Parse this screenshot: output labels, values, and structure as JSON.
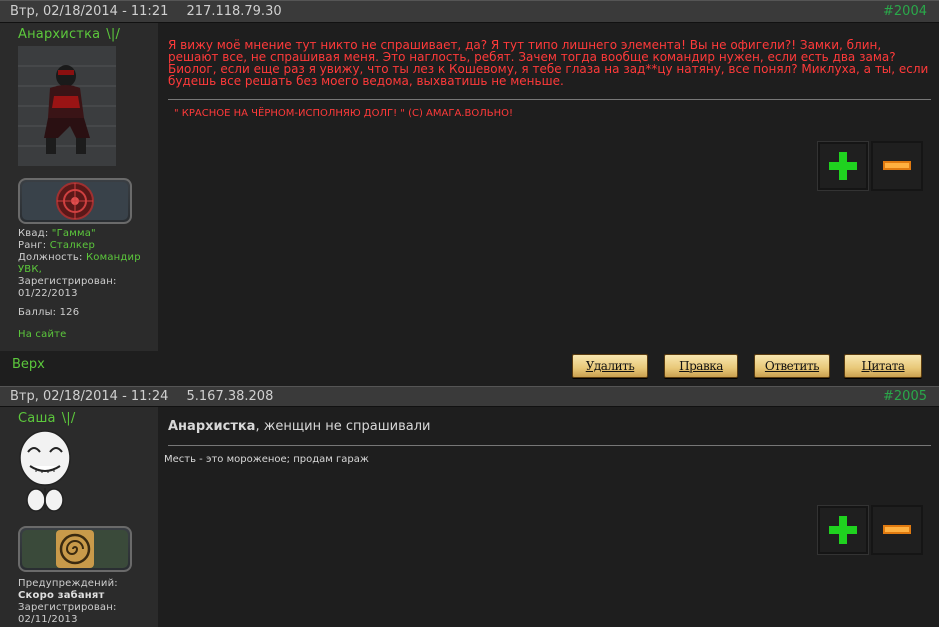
{
  "posts": [
    {
      "date": "Втр, 02/18/2014 - 11:21",
      "ip": "217.118.79.30",
      "number": "#2004",
      "author": "Анархистка",
      "author_sep": "\\|/",
      "info": {
        "squad_label": "Квад:",
        "squad_value": "\"Гамма\"",
        "rank_label": "Ранг:",
        "rank_value": "Сталкер",
        "position_label": "Должность:",
        "position_value": "Командир УВК,",
        "registered_label": "Зарегистрирован:",
        "registered_value": "01/22/2013",
        "points": "Баллы: 126",
        "online": "На сайте"
      },
      "message": "Я вижу моё мнение тут никто не спрашивает, да? Я тут типо лишнего элемента! Вы не офигели?! Замки, блин, решают все, не спрашивая меня. Это наглость, ребят. Зачем тогда вообще командир нужен, если есть два зама? Биолог, если еще раз я увижу, что ты лез к Кошевому, я тебе глаза на зад**цу натяну, все понял? Миклуха, а ты, если будешь все решать без моего ведома, выхватишь не меньше.",
      "signature": "\" КРАСНОЕ НА ЧЁРНОМ-ИСПОЛНЯЮ ДОЛГ! \" (С) АМАГА.ВОЛЬНО!"
    },
    {
      "date": "Втр, 02/18/2014 - 11:24",
      "ip": "5.167.38.208",
      "number": "#2005",
      "author": "Саша",
      "author_sep": "\\|/",
      "info": {
        "warnings_label": "Предупреждений:",
        "warnings_value": "Скоро забанят",
        "registered_label": "Зарегистрирован:",
        "registered_value": "02/11/2013"
      },
      "quote_name": "Анархистка",
      "message": ", женщин не спрашивали",
      "signature": "Месть - это мороженое; продам гараж"
    }
  ],
  "actions": {
    "top": "Верх",
    "delete": "Удалить",
    "edit": "Правка",
    "reply": "Ответить",
    "quote": "Цитата"
  },
  "colors": {
    "accent": "#5cc83c",
    "message_red": "#ff3a3a",
    "button_gold": "#e8c878"
  }
}
